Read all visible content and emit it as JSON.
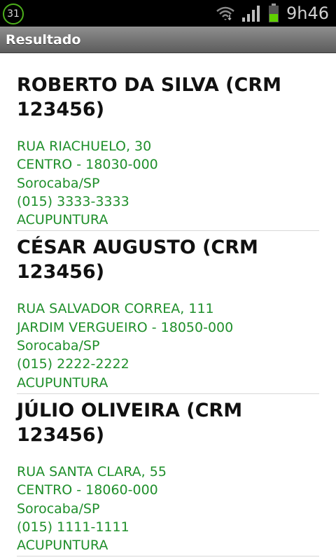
{
  "status_bar": {
    "calendar_badge": "31",
    "time": "9h46"
  },
  "header": {
    "title": "Resultado"
  },
  "results": [
    {
      "name": "ROBERTO DA SILVA (CRM 123456)",
      "address": "RUA RIACHUELO, 30",
      "district_zip": "CENTRO - 18030-000",
      "city": "Sorocaba/SP",
      "phone": "(015) 3333-3333",
      "specialty": "ACUPUNTURA"
    },
    {
      "name": "CÉSAR AUGUSTO (CRM 123456)",
      "address": "RUA SALVADOR CORREA, 111",
      "district_zip": "JARDIM VERGUEIRO - 18050-000",
      "city": "Sorocaba/SP",
      "phone": "(015) 2222-2222",
      "specialty": "ACUPUNTURA"
    },
    {
      "name": "JÚLIO OLIVEIRA (CRM 123456)",
      "address": "RUA SANTA CLARA, 55",
      "district_zip": "CENTRO - 18060-000",
      "city": "Sorocaba/SP",
      "phone": "(015) 1111-1111",
      "specialty": "ACUPUNTURA"
    }
  ]
}
